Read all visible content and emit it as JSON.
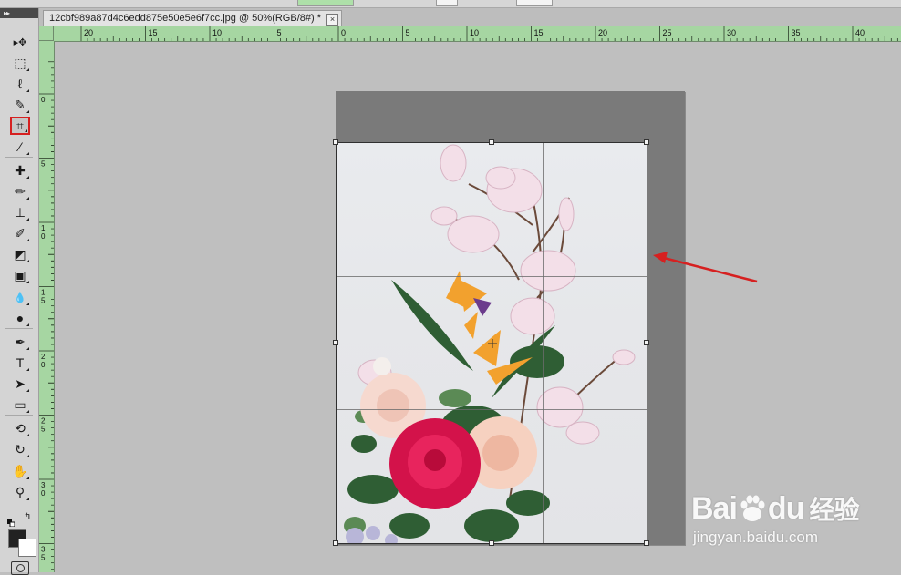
{
  "document": {
    "tab_title": "12cbf989a87d4c6edd875e50e5e6f7cc.jpg @ 50%(RGB/8#) *",
    "close_glyph": "×"
  },
  "toolbox": {
    "grip_label": "▸▸",
    "tools": [
      {
        "name": "move-tool",
        "icon": "move-icon",
        "glyph": "▸✥"
      },
      {
        "name": "marquee-tool",
        "icon": "rect-marquee-icon",
        "glyph": "⬚"
      },
      {
        "name": "lasso-tool",
        "icon": "lasso-icon",
        "glyph": "ℓ"
      },
      {
        "name": "quick-select-tool",
        "icon": "quick-select-icon",
        "glyph": "✎"
      },
      {
        "name": "crop-tool",
        "icon": "crop-icon",
        "glyph": "⌗",
        "selected": true
      },
      {
        "name": "eyedropper-tool",
        "icon": "eyedropper-icon",
        "glyph": "⁄"
      },
      {
        "name": "healing-brush-tool",
        "icon": "bandage-icon",
        "glyph": "✚"
      },
      {
        "name": "brush-tool",
        "icon": "brush-icon",
        "glyph": "✏"
      },
      {
        "name": "clone-stamp-tool",
        "icon": "stamp-icon",
        "glyph": "⊥"
      },
      {
        "name": "history-brush-tool",
        "icon": "history-brush-icon",
        "glyph": "✐"
      },
      {
        "name": "eraser-tool",
        "icon": "eraser-icon",
        "glyph": "◩"
      },
      {
        "name": "gradient-tool",
        "icon": "gradient-icon",
        "glyph": "▣"
      },
      {
        "name": "blur-tool",
        "icon": "drop-icon",
        "glyph": "💧"
      },
      {
        "name": "dodge-tool",
        "icon": "dodge-icon",
        "glyph": "●"
      },
      {
        "name": "pen-tool",
        "icon": "pen-icon",
        "glyph": "✒"
      },
      {
        "name": "type-tool",
        "icon": "type-icon",
        "glyph": "T"
      },
      {
        "name": "path-select-tool",
        "icon": "arrow-cursor-icon",
        "glyph": "➤"
      },
      {
        "name": "shape-tool",
        "icon": "rectangle-icon",
        "glyph": "▭"
      },
      {
        "name": "3d-rotate-tool",
        "icon": "3d-rotate-icon",
        "glyph": "⟲"
      },
      {
        "name": "3d-orbit-tool",
        "icon": "3d-orbit-icon",
        "glyph": "↻"
      },
      {
        "name": "hand-tool",
        "icon": "hand-icon",
        "glyph": "✋"
      },
      {
        "name": "zoom-tool",
        "icon": "magnifier-icon",
        "glyph": "⚲"
      }
    ]
  },
  "ruler": {
    "h_labels": [
      "20",
      "15",
      "10",
      "5",
      "0",
      "5",
      "10",
      "15",
      "20",
      "25",
      "30",
      "35",
      "40"
    ],
    "v_labels": [
      "0",
      "5",
      "1 0",
      "1 5",
      "2 0",
      "2 5",
      "3 0",
      "3 5"
    ]
  },
  "watermark": {
    "brand": "Bai",
    "brand_tail": "du",
    "product": "经验",
    "url": "jingyan.baidu.com"
  },
  "colors": {
    "ruler_bg": "#a6d6a2",
    "annotation_red": "#d62020",
    "crop_shield": "#7a7a7a"
  }
}
